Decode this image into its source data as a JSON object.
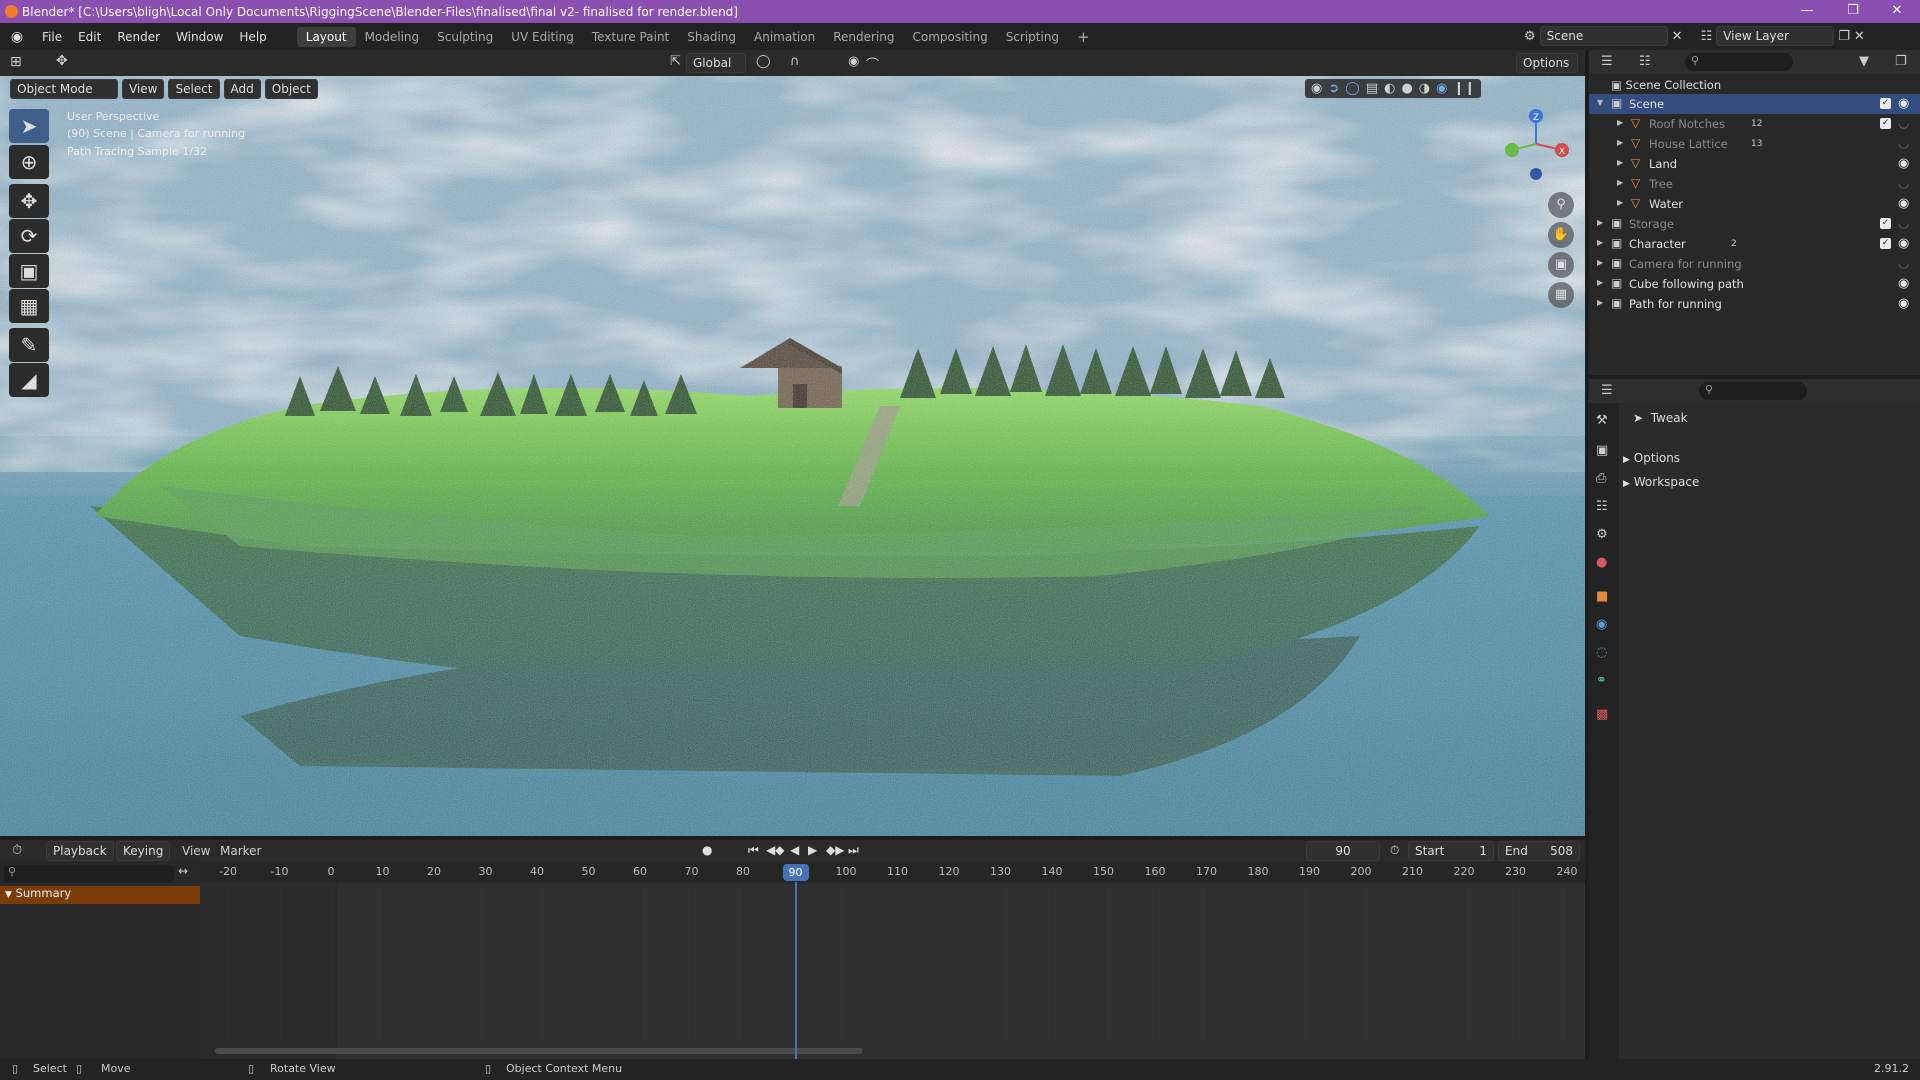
{
  "title_bar": {
    "title": "Blender* [C:\\Users\\bligh\\Local Only Documents\\RiggingScene\\Blender-Files\\finalised\\final v2-  finalised for render.blend]"
  },
  "menu": [
    "File",
    "Edit",
    "Render",
    "Window",
    "Help"
  ],
  "workspace_tabs": [
    "Layout",
    "Modeling",
    "Sculpting",
    "UV Editing",
    "Texture Paint",
    "Shading",
    "Animation",
    "Rendering",
    "Compositing",
    "Scripting"
  ],
  "active_workspace": "Layout",
  "add_tab": "+",
  "scene_name": "Scene",
  "view_layer": "View Layer",
  "viewport_header": {
    "mode": "Object Mode",
    "menus": [
      "View",
      "Select",
      "Add",
      "Object"
    ],
    "orientation": "Global",
    "options": "Options"
  },
  "viewport_overlay": {
    "line1": "User Perspective",
    "line2": "(90) Scene | Camera for running",
    "line3": "Path Tracing Sample 1/32"
  },
  "navigation_gizmo": {
    "z": "Z",
    "x": "X"
  },
  "tools": [
    "select-box",
    "cursor",
    "move",
    "rotate",
    "scale",
    "transform",
    "annotate",
    "measure"
  ],
  "outliner": {
    "root": "Scene Collection",
    "rows": [
      {
        "name": "Scene",
        "indent": 1,
        "selected": true,
        "checked": true,
        "visible": true,
        "dim": false
      },
      {
        "name": "Roof Notches",
        "indent": 2,
        "selected": false,
        "checked": true,
        "visible": false,
        "dim": true,
        "badge": "12"
      },
      {
        "name": "House Lattice",
        "indent": 2,
        "selected": false,
        "checked": false,
        "visible": false,
        "dim": true,
        "badge": "13"
      },
      {
        "name": "Land",
        "indent": 2,
        "selected": false,
        "checked": false,
        "visible": true,
        "dim": false
      },
      {
        "name": "Tree",
        "indent": 2,
        "selected": false,
        "checked": false,
        "visible": false,
        "dim": true
      },
      {
        "name": "Water",
        "indent": 2,
        "selected": false,
        "checked": false,
        "visible": true,
        "dim": false
      },
      {
        "name": "Storage",
        "indent": 1,
        "selected": false,
        "checked": true,
        "visible": false,
        "dim": true
      },
      {
        "name": "Character",
        "indent": 1,
        "selected": false,
        "checked": true,
        "visible": true,
        "dim": false,
        "badge": "2"
      },
      {
        "name": "Camera for running",
        "indent": 1,
        "selected": false,
        "checked": false,
        "visible": false,
        "dim": true
      },
      {
        "name": "Cube following path",
        "indent": 1,
        "selected": false,
        "checked": false,
        "visible": true,
        "dim": false
      },
      {
        "name": "Path for running",
        "indent": 1,
        "selected": false,
        "checked": false,
        "visible": true,
        "dim": false
      }
    ]
  },
  "properties": {
    "tool_name": "Tweak",
    "panels": [
      "Options",
      "Workspace"
    ]
  },
  "timeline": {
    "menus": [
      "Playback",
      "Keying",
      "View",
      "Marker"
    ],
    "current_frame": "90",
    "start_label": "Start",
    "start": "1",
    "end_label": "End",
    "end": "508",
    "ticks": [
      "-20",
      "-10",
      "0",
      "10",
      "20",
      "30",
      "40",
      "50",
      "60",
      "70",
      "80",
      "90",
      "100",
      "110",
      "120",
      "130",
      "140",
      "150",
      "160",
      "170",
      "180",
      "190",
      "200",
      "210",
      "220",
      "230",
      "240"
    ],
    "summary": "Summary"
  },
  "status_bar": {
    "select": "Select",
    "move": "Move",
    "rotate": "Rotate View",
    "context": "Object Context Menu",
    "version": "2.91.2"
  },
  "colors": {
    "accent": "#4772b3",
    "title_bar": "#8a4fb0",
    "grass": "#5fc43a",
    "water": "#3e8fae"
  }
}
